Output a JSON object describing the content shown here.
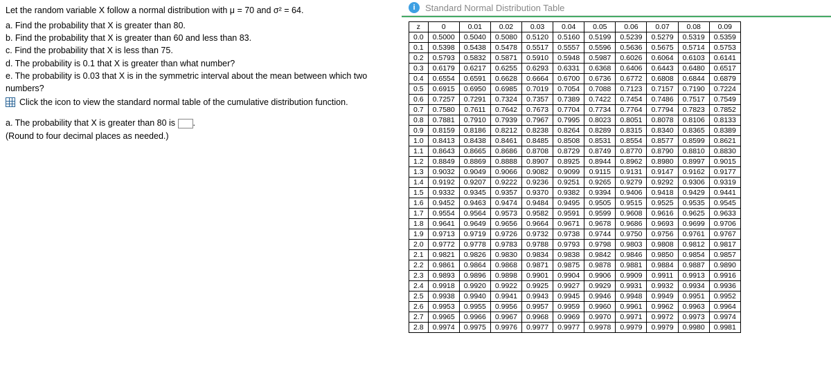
{
  "problem": {
    "intro_html": "Let the random variable X follow a normal distribution with μ = 70 and σ² = 64.",
    "parts": [
      "a.  Find the probability that X is greater than 80.",
      "b.  Find the probability that X is greater than 60 and less than 83.",
      "c.  Find the probability that X is less than 75.",
      "d.  The probability is 0.1 that X is greater than what number?",
      "e.  The probability is 0.03 that X is in the symmetric interval about the mean between which two numbers?"
    ],
    "link_text": "Click the icon to view the standard normal table of the cumulative distribution function."
  },
  "answer": {
    "line1": "a. The probability that X is greater than 80 is",
    "round": "(Round to four decimal places as needed.)",
    "period": "."
  },
  "popup": {
    "title": "Standard Normal Distribution Table"
  },
  "table": {
    "col_head": [
      "z",
      "0",
      "0.01",
      "0.02",
      "0.03",
      "0.04",
      "0.05",
      "0.06",
      "0.07",
      "0.08",
      "0.09"
    ],
    "rows": [
      [
        "0.0",
        "0.5000",
        "0.5040",
        "0.5080",
        "0.5120",
        "0.5160",
        "0.5199",
        "0.5239",
        "0.5279",
        "0.5319",
        "0.5359"
      ],
      [
        "0.1",
        "0.5398",
        "0.5438",
        "0.5478",
        "0.5517",
        "0.5557",
        "0.5596",
        "0.5636",
        "0.5675",
        "0.5714",
        "0.5753"
      ],
      [
        "0.2",
        "0.5793",
        "0.5832",
        "0.5871",
        "0.5910",
        "0.5948",
        "0.5987",
        "0.6026",
        "0.6064",
        "0.6103",
        "0.6141"
      ],
      [
        "0.3",
        "0.6179",
        "0.6217",
        "0.6255",
        "0.6293",
        "0.6331",
        "0.6368",
        "0.6406",
        "0.6443",
        "0.6480",
        "0.6517"
      ],
      [
        "0.4",
        "0.6554",
        "0.6591",
        "0.6628",
        "0.6664",
        "0.6700",
        "0.6736",
        "0.6772",
        "0.6808",
        "0.6844",
        "0.6879"
      ],
      [
        "0.5",
        "0.6915",
        "0.6950",
        "0.6985",
        "0.7019",
        "0.7054",
        "0.7088",
        "0.7123",
        "0.7157",
        "0.7190",
        "0.7224"
      ],
      [
        "0.6",
        "0.7257",
        "0.7291",
        "0.7324",
        "0.7357",
        "0.7389",
        "0.7422",
        "0.7454",
        "0.7486",
        "0.7517",
        "0.7549"
      ],
      [
        "0.7",
        "0.7580",
        "0.7611",
        "0.7642",
        "0.7673",
        "0.7704",
        "0.7734",
        "0.7764",
        "0.7794",
        "0.7823",
        "0.7852"
      ],
      [
        "0.8",
        "0.7881",
        "0.7910",
        "0.7939",
        "0.7967",
        "0.7995",
        "0.8023",
        "0.8051",
        "0.8078",
        "0.8106",
        "0.8133"
      ],
      [
        "0.9",
        "0.8159",
        "0.8186",
        "0.8212",
        "0.8238",
        "0.8264",
        "0.8289",
        "0.8315",
        "0.8340",
        "0.8365",
        "0.8389"
      ],
      [
        "1.0",
        "0.8413",
        "0.8438",
        "0.8461",
        "0.8485",
        "0.8508",
        "0.8531",
        "0.8554",
        "0.8577",
        "0.8599",
        "0.8621"
      ],
      [
        "1.1",
        "0.8643",
        "0.8665",
        "0.8686",
        "0.8708",
        "0.8729",
        "0.8749",
        "0.8770",
        "0.8790",
        "0.8810",
        "0.8830"
      ],
      [
        "1.2",
        "0.8849",
        "0.8869",
        "0.8888",
        "0.8907",
        "0.8925",
        "0.8944",
        "0.8962",
        "0.8980",
        "0.8997",
        "0.9015"
      ],
      [
        "1.3",
        "0.9032",
        "0.9049",
        "0.9066",
        "0.9082",
        "0.9099",
        "0.9115",
        "0.9131",
        "0.9147",
        "0.9162",
        "0.9177"
      ],
      [
        "1.4",
        "0.9192",
        "0.9207",
        "0.9222",
        "0.9236",
        "0.9251",
        "0.9265",
        "0.9279",
        "0.9292",
        "0.9306",
        "0.9319"
      ],
      [
        "1.5",
        "0.9332",
        "0.9345",
        "0.9357",
        "0.9370",
        "0.9382",
        "0.9394",
        "0.9406",
        "0.9418",
        "0.9429",
        "0.9441"
      ],
      [
        "1.6",
        "0.9452",
        "0.9463",
        "0.9474",
        "0.9484",
        "0.9495",
        "0.9505",
        "0.9515",
        "0.9525",
        "0.9535",
        "0.9545"
      ],
      [
        "1.7",
        "0.9554",
        "0.9564",
        "0.9573",
        "0.9582",
        "0.9591",
        "0.9599",
        "0.9608",
        "0.9616",
        "0.9625",
        "0.9633"
      ],
      [
        "1.8",
        "0.9641",
        "0.9649",
        "0.9656",
        "0.9664",
        "0.9671",
        "0.9678",
        "0.9686",
        "0.9693",
        "0.9699",
        "0.9706"
      ],
      [
        "1.9",
        "0.9713",
        "0.9719",
        "0.9726",
        "0.9732",
        "0.9738",
        "0.9744",
        "0.9750",
        "0.9756",
        "0.9761",
        "0.9767"
      ],
      [
        "2.0",
        "0.9772",
        "0.9778",
        "0.9783",
        "0.9788",
        "0.9793",
        "0.9798",
        "0.9803",
        "0.9808",
        "0.9812",
        "0.9817"
      ],
      [
        "2.1",
        "0.9821",
        "0.9826",
        "0.9830",
        "0.9834",
        "0.9838",
        "0.9842",
        "0.9846",
        "0.9850",
        "0.9854",
        "0.9857"
      ],
      [
        "2.2",
        "0.9861",
        "0.9864",
        "0.9868",
        "0.9871",
        "0.9875",
        "0.9878",
        "0.9881",
        "0.9884",
        "0.9887",
        "0.9890"
      ],
      [
        "2.3",
        "0.9893",
        "0.9896",
        "0.9898",
        "0.9901",
        "0.9904",
        "0.9906",
        "0.9909",
        "0.9911",
        "0.9913",
        "0.9916"
      ],
      [
        "2.4",
        "0.9918",
        "0.9920",
        "0.9922",
        "0.9925",
        "0.9927",
        "0.9929",
        "0.9931",
        "0.9932",
        "0.9934",
        "0.9936"
      ],
      [
        "2.5",
        "0.9938",
        "0.9940",
        "0.9941",
        "0.9943",
        "0.9945",
        "0.9946",
        "0.9948",
        "0.9949",
        "0.9951",
        "0.9952"
      ],
      [
        "2.6",
        "0.9953",
        "0.9955",
        "0.9956",
        "0.9957",
        "0.9959",
        "0.9960",
        "0.9961",
        "0.9962",
        "0.9963",
        "0.9964"
      ],
      [
        "2.7",
        "0.9965",
        "0.9966",
        "0.9967",
        "0.9968",
        "0.9969",
        "0.9970",
        "0.9971",
        "0.9972",
        "0.9973",
        "0.9974"
      ],
      [
        "2.8",
        "0.9974",
        "0.9975",
        "0.9976",
        "0.9977",
        "0.9977",
        "0.9978",
        "0.9979",
        "0.9979",
        "0.9980",
        "0.9981"
      ]
    ]
  }
}
